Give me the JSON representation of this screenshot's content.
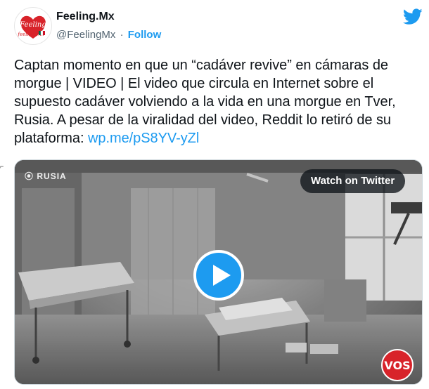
{
  "account": {
    "display_name": "Feeling.Mx",
    "handle": "@FeelingMx",
    "separator": "·",
    "follow_label": "Follow",
    "avatar_lettering": "Feeling.mx"
  },
  "tweet": {
    "text": "Captan momento en que un “cadáver revive” en cámaras de morgue | VIDEO | El video que circula en Internet sobre el supuesto cadáver volviendo a la vida en una morgue en Tver, Rusia. A pesar de la viralidad del video, Reddit lo retiró de su plataforma: ",
    "link_text": "wp.me/pS8YV-yZl"
  },
  "media": {
    "overlay_tag": "RUSIA",
    "watch_label": "Watch on Twitter",
    "play_icon": "play-icon",
    "watermark_logo": "VOS"
  },
  "colors": {
    "accent": "#1d9bf0",
    "text": "#0f1419",
    "muted": "#536471"
  }
}
